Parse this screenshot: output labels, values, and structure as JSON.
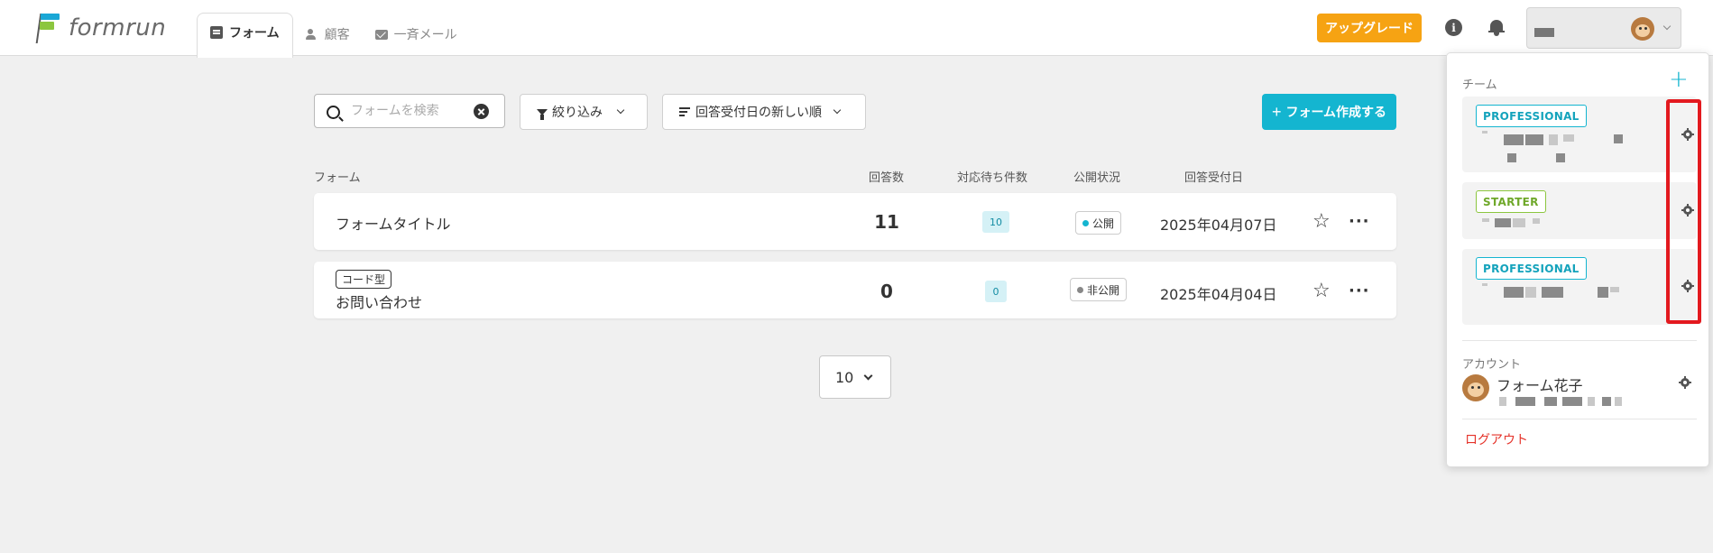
{
  "header": {
    "logo_text": "formrun",
    "tabs": [
      {
        "label": "フォーム",
        "active": true
      },
      {
        "label": "顧客",
        "active": false
      },
      {
        "label": "一斉メール",
        "active": false
      }
    ],
    "upgrade_label": "アップグレード",
    "info_glyph": "i"
  },
  "toolbar": {
    "search_placeholder": "フォームを検索",
    "filter_label": "絞り込み",
    "sort_label": "回答受付日の新しい順",
    "create_label": "フォーム作成する",
    "create_glyph": "+"
  },
  "table": {
    "headers": {
      "form": "フォーム",
      "answers": "回答数",
      "pending": "対応待ち件数",
      "status": "公開状況",
      "date": "回答受付日"
    },
    "rows": [
      {
        "badge": "",
        "title": "フォームタイトル",
        "answers": "11",
        "pending": "10",
        "status": "公開",
        "status_color": "#14b5d0",
        "date": "2025年04月07日",
        "star": "☆",
        "more": "···"
      },
      {
        "badge": "コード型",
        "title": "お問い合わせ",
        "answers": "0",
        "pending": "0",
        "status": "非公開",
        "status_color": "#888888",
        "date": "2025年04月04日",
        "star": "☆",
        "more": "···"
      }
    ]
  },
  "pager": {
    "value": "10"
  },
  "panel": {
    "team_label": "チーム",
    "add_glyph": "+",
    "teams": [
      {
        "plan": "PROFESSIONAL"
      },
      {
        "plan": "STARTER"
      },
      {
        "plan": "PROFESSIONAL"
      }
    ],
    "account_label": "アカウント",
    "account_name": "フォーム花子",
    "logout_label": "ログアウト"
  },
  "colors": {
    "accent": "#14b5d0",
    "upgrade": "#f6a313",
    "highlight_box": "#e3191f",
    "logout": "#e5332a"
  }
}
